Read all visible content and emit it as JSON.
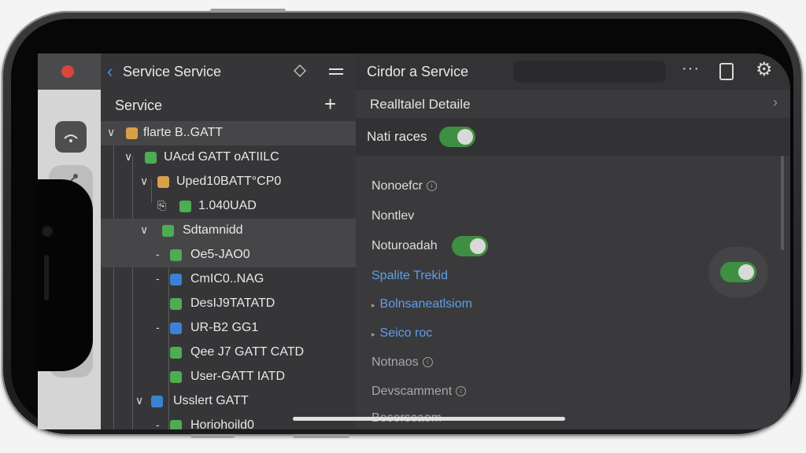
{
  "sidebar": {
    "title": "Service Service",
    "section_label": "Service",
    "add_label": "+",
    "tree": [
      {
        "label": "flarte B..GATT",
        "color": "#d9a04a"
      },
      {
        "label": "UAcd GATT oATIILC",
        "color": "#4cad52"
      },
      {
        "label": "Uped10BATT°CP0",
        "color": "#d9a04a"
      },
      {
        "label": "1.040UAD",
        "color": "#4cad52"
      },
      {
        "label": "Sdtamnidd",
        "color": "#4cad52"
      },
      {
        "label": "Oe5-JAO0",
        "color": "#4cad52"
      },
      {
        "label": "CmIC0..NAG",
        "color": "#3b82d6"
      },
      {
        "label": "DesIJ9TATATD",
        "color": "#4cad52"
      },
      {
        "label": "UR-B2 GG1",
        "color": "#3b82d6"
      },
      {
        "label": "Qee J7 GATT CATD",
        "color": "#4cad52"
      },
      {
        "label": "User-GATT IATD",
        "color": "#4cad52"
      },
      {
        "label": "Usslert GATT",
        "color": "#3b82d6"
      },
      {
        "label": "Horiohoild0",
        "color": "#4cad52"
      }
    ]
  },
  "detail": {
    "title": "Cirdor a  Service",
    "subtitle": "Realltalel Detaile",
    "toggle_label": "Nati races",
    "items": [
      {
        "label": "Nonoefcr"
      },
      {
        "label": "Nontlev"
      },
      {
        "label": "Noturoadah"
      },
      {
        "label": "Spalite Trekid"
      },
      {
        "label": "Bolnsaneatlsiom"
      },
      {
        "label": "Seico roc"
      },
      {
        "label": "Notnaos"
      },
      {
        "label": "Devscamment"
      },
      {
        "label": "Beserscaom"
      }
    ]
  },
  "colors": {
    "accent": "#4a8df0",
    "toggle_on": "#3e8f42"
  }
}
